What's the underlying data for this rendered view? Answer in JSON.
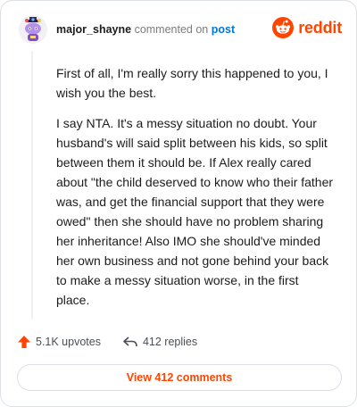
{
  "header": {
    "username": "major_shayne",
    "action_text": "commented on",
    "post_link": "post",
    "logo_text": "reddit",
    "avatar_icon": "snoo-avatar-icon",
    "logo_icon": "reddit-alien-icon"
  },
  "comment": {
    "paragraphs": [
      "First of all, I'm really sorry this happened to you, I wish you the best.",
      "I say NTA. It's a messy situation no doubt. Your husband's will said split between his kids, so split between them it should be. If Alex really cared about \"the child deserved to know who their father was, and get the financial support that they were owed\" then she should have no problem sharing her inheritance! Also IMO she should've minded her own business and not gone behind your back to make a messy situation worse, in the first place."
    ]
  },
  "actions": {
    "upvotes": "5.1K upvotes",
    "replies": "412 replies",
    "upvote_icon": "upvote-arrow-icon",
    "reply_icon": "reply-arrow-icon"
  },
  "footer": {
    "view_comments": "View 412 comments"
  },
  "colors": {
    "brand": "#ff4500",
    "link": "#0079d3",
    "muted": "#7c7c7c",
    "border": "#dcdfe3"
  }
}
